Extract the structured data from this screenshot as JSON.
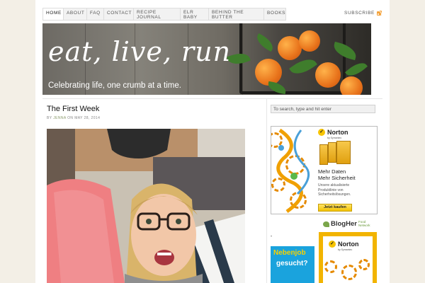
{
  "nav": {
    "items": [
      {
        "label": "HOME",
        "active": true
      },
      {
        "label": "ABOUT",
        "active": false
      },
      {
        "label": "FAQ",
        "active": false
      },
      {
        "label": "CONTACT",
        "active": false
      },
      {
        "label": "RECIPE JOURNAL",
        "active": false
      },
      {
        "label": "ELR BABY",
        "active": false
      },
      {
        "label": "BEHIND THE BUTTER",
        "active": false
      },
      {
        "label": "BOOKS",
        "active": false
      }
    ],
    "subscribe_label": "SUBSCRIBE",
    "subscribe_icon": "rss-icon"
  },
  "banner": {
    "title": "eat, live, run",
    "tagline": "Celebrating life, one crumb at a time."
  },
  "post": {
    "title": "The First Week",
    "meta_prefix": "by",
    "author": "JENNA",
    "meta_mid": "on",
    "date": "MAY 28, 2014"
  },
  "sidebar": {
    "search_placeholder": "To search, type and hit enter",
    "ad1": {
      "brand": "Norton",
      "brand_sub": "by Symantec",
      "headline_1": "Mehr Daten",
      "headline_2": "Mehr Sicherheit",
      "body_1": "Unsere aktualisierte",
      "body_2": "Produktlinie von",
      "body_3": "Sicherheitslösungen.",
      "button": "Jetzt kaufen"
    },
    "blogher_logo": "BlogHer",
    "blogher_sub_1": "Food",
    "blogher_sub_2": "Network",
    "dot": "•",
    "ad2": {
      "line1": "Nebenjob",
      "line2": "gesucht?"
    },
    "ad3": {
      "brand": "Norton",
      "brand_sub": "by Symantec"
    }
  },
  "colors": {
    "page_bg": "#f3efe6",
    "rss": "#f4a23a",
    "norton_yellow": "#f7c400",
    "ad_blue": "#1aa3dd"
  }
}
